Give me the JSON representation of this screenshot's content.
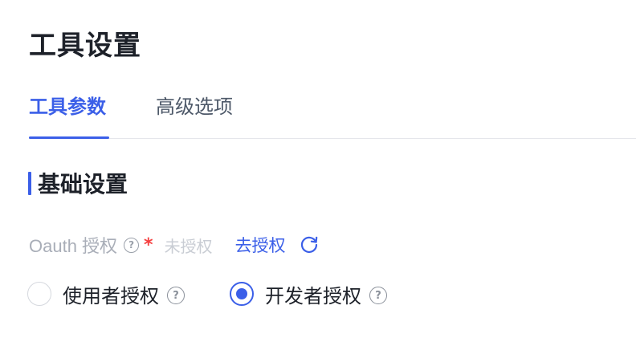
{
  "page": {
    "title": "工具设置"
  },
  "tabs": [
    {
      "label": "工具参数",
      "active": true
    },
    {
      "label": "高级选项",
      "active": false
    }
  ],
  "section": {
    "title": "基础设置"
  },
  "oauth_field": {
    "label": "Oauth 授权",
    "help_glyph": "?",
    "required_mark": "*",
    "status": "未授权",
    "action_label": "去授权",
    "refresh_icon": "refresh-icon"
  },
  "auth_mode": {
    "options": [
      {
        "label": "使用者授权",
        "help_glyph": "?",
        "selected": false
      },
      {
        "label": "开发者授权",
        "help_glyph": "?",
        "selected": true
      }
    ]
  },
  "colors": {
    "accent": "#3b5fe8",
    "required": "#f53f3f",
    "text_primary": "#1d2129",
    "text_secondary": "#4e5969",
    "text_muted": "#a9aeb8",
    "divider": "#e5e6eb"
  }
}
